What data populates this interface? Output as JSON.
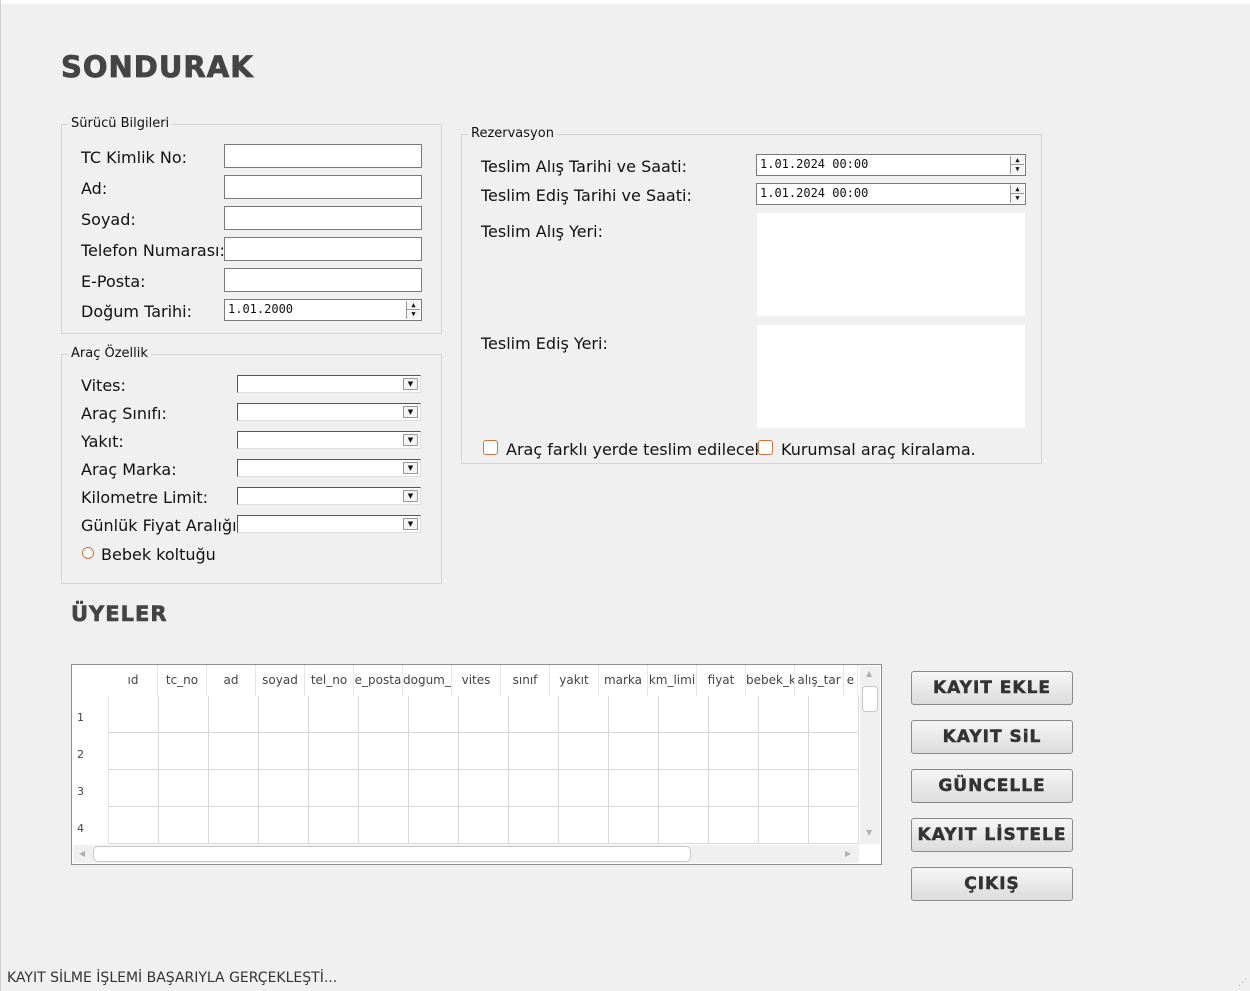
{
  "app": {
    "title": "SONDURAK"
  },
  "driver": {
    "group_label": "Sürücü Bilgileri",
    "tc_label": "TC Kimlik No:",
    "ad_label": "Ad:",
    "soyad_label": "Soyad:",
    "telefon_label": "Telefon Numarası:",
    "eposta_label": "E-Posta:",
    "dogum_label": "Doğum Tarihi:",
    "dogum_value": "1.01.2000"
  },
  "vehicle": {
    "group_label": "Araç Özellik",
    "vites_label": "Vites:",
    "sinif_label": "Araç Sınıfı:",
    "yakit_label": "Yakıt:",
    "marka_label": "Araç Marka:",
    "km_label": "Kilometre Limit:",
    "fiyat_label": "Günlük Fiyat Aralığı:",
    "bebek_label": "Bebek koltuğu"
  },
  "reservation": {
    "group_label": "Rezervasyon",
    "alis_tarih_label": "Teslim Alış Tarihi ve Saati:",
    "alis_tarih_value": "1.01.2024 00:00",
    "edis_tarih_label": "Teslim Ediş Tarihi ve Saati:",
    "edis_tarih_value": "1.01.2024 00:00",
    "alis_yeri_label": "Teslim Alış Yeri:",
    "edis_yeri_label": "Teslim Ediş Yeri:",
    "farkli_yer_label": "Araç farklı yerde teslim edilecek.",
    "kurumsal_label": "Kurumsal araç kiralama."
  },
  "members": {
    "title": "ÜYELER",
    "columns": [
      "ıd",
      "tc_no",
      "ad",
      "soyad",
      "tel_no",
      "e_posta",
      "dogum_ta",
      "vites",
      "sınıf",
      "yakıt",
      "marka",
      "km_limi",
      "fiyat",
      "bebek_kol",
      "alış_tar",
      "e"
    ],
    "rows": [
      "1",
      "2",
      "3",
      "4"
    ]
  },
  "buttons": {
    "add": "KAYIT EKLE",
    "delete": "KAYIT SiL",
    "update": "GÜNCELLE",
    "list": "KAYIT LİSTELE",
    "exit": "ÇIKIŞ"
  },
  "status": {
    "text": "KAYIT SİLME İŞLEMİ BAŞARIYLA GERÇEKLEŞTİ..."
  }
}
